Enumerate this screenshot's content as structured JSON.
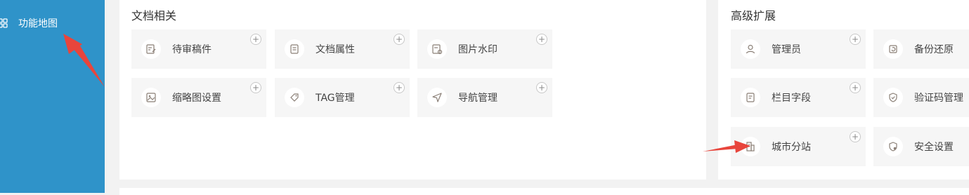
{
  "sidebar": {
    "item": {
      "label": "功能地图",
      "icon": "grid-icon"
    }
  },
  "doc_panel": {
    "title": "文档相关",
    "cards": [
      {
        "label": "待审稿件",
        "icon": "edit-doc-icon"
      },
      {
        "label": "文档属性",
        "icon": "document-icon"
      },
      {
        "label": "图片水印",
        "icon": "image-watermark-icon"
      },
      {
        "label": "缩略图设置",
        "icon": "image-icon"
      },
      {
        "label": "TAG管理",
        "icon": "tag-icon"
      },
      {
        "label": "导航管理",
        "icon": "navigation-icon"
      }
    ]
  },
  "adv_panel": {
    "title": "高级扩展",
    "cards": [
      {
        "label": "管理员",
        "icon": "user-icon"
      },
      {
        "label": "备份还原",
        "icon": "backup-icon"
      },
      {
        "label": "栏目字段",
        "icon": "field-doc-icon"
      },
      {
        "label": "验证码管理",
        "icon": "shield-check-icon"
      },
      {
        "label": "城市分站",
        "icon": "building-icon"
      },
      {
        "label": "安全设置",
        "icon": "shield-gear-icon"
      }
    ]
  },
  "plus_glyph": "+",
  "colors": {
    "sidebar": "#2f93c9",
    "card": "#f6f6f6",
    "arrow": "#e8453c"
  }
}
